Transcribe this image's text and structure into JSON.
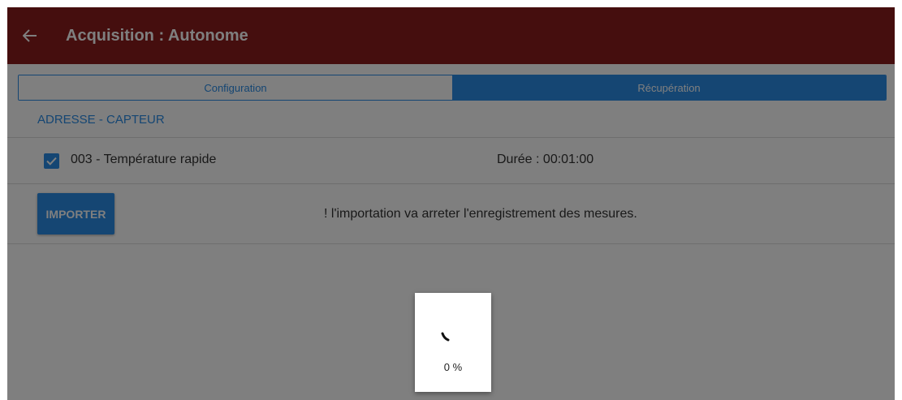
{
  "toolbar": {
    "title": "Acquisition : Autonome",
    "back_icon": "arrow-left-icon",
    "color": "#8a1c1c"
  },
  "tabs": [
    {
      "label": "Configuration",
      "active": false
    },
    {
      "label": "Récupération",
      "active": true
    }
  ],
  "section": {
    "header": "ADRESSE - CAPTEUR"
  },
  "sensor": {
    "checked": true,
    "label": "003 - Température rapide",
    "duration": "Durée : 00:01:00"
  },
  "import": {
    "button_label": "IMPORTER",
    "warning": "! l'importation va arreter l'enregistrement des mesures."
  },
  "progress": {
    "value_text": "0 %",
    "value": 0
  },
  "colors": {
    "accent": "#2a8ce6",
    "toolbar": "#8a1c1c"
  }
}
